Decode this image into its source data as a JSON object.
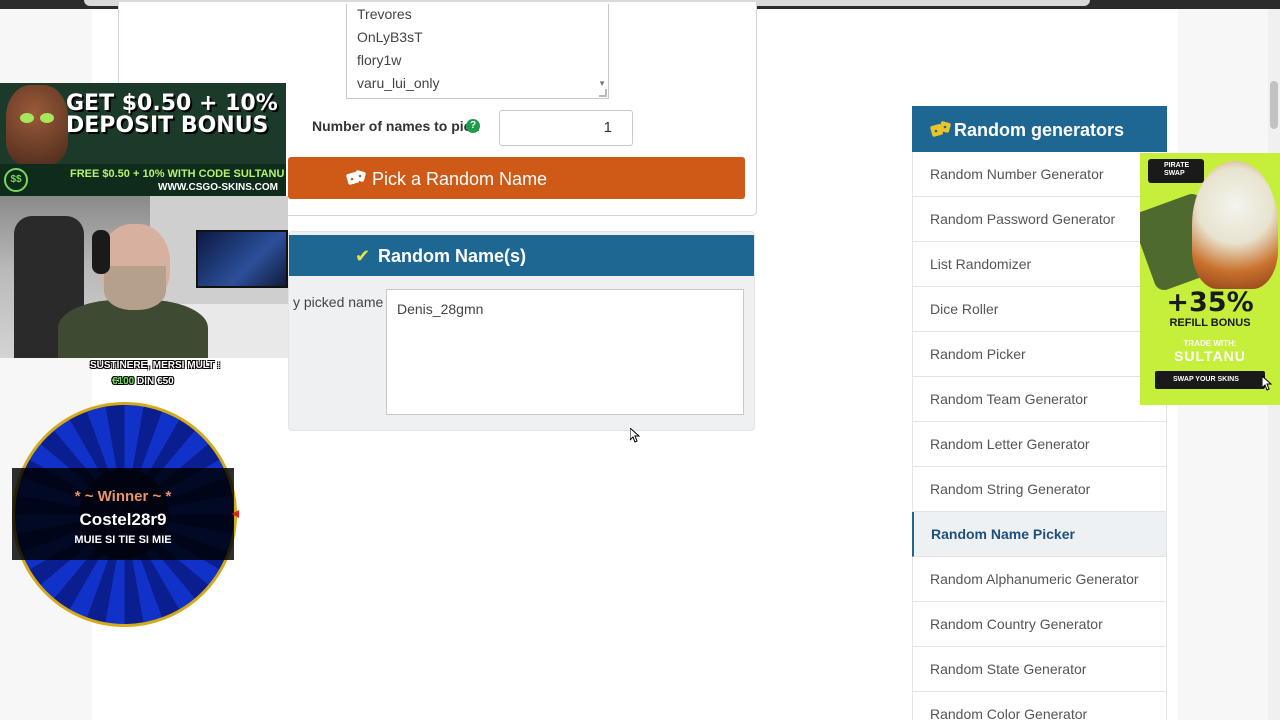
{
  "names_list": {
    "visible_names": [
      "Trevores",
      "OnLyB3sT",
      "flory1w",
      "varu_lui_only"
    ]
  },
  "pick_count": {
    "label": "Number of names to pick",
    "help_icon": "question-circle-icon",
    "value": "1"
  },
  "pick_button": {
    "label": "Pick a Random Name",
    "icon": "dice-icon"
  },
  "result": {
    "title": "Random Name(s)",
    "icon": "check-icon",
    "picked_label": "y picked name",
    "value": "Denis_28gmn"
  },
  "sidebar": {
    "title": "Random generators",
    "icon": "dice-icon",
    "items": [
      "Random Number Generator",
      "Random Password Generator",
      "List Randomizer",
      "Dice Roller",
      "Random Picker",
      "Random Team Generator",
      "Random Letter Generator",
      "Random String Generator",
      "Random Name Picker",
      "Random Alphanumeric Generator",
      "Random Country Generator",
      "Random State Generator",
      "Random Color Generator"
    ],
    "active_item": "Random Name Picker"
  },
  "overlay": {
    "banner": {
      "headline": "GET $0.50 + 10% DEPOSIT BONUS",
      "code_text": "FREE $0.50 + 10% WITH CODE SULTANU",
      "site": "WWW.CSGO-SKINS.COM"
    },
    "support": {
      "line1": "SUSTINERE, MERSI MULT :",
      "amount": "€100",
      "line2_rest": " DIN €50"
    },
    "wheel": {
      "winner_label": "* ~ Winner ~ *",
      "winner_name": "Costel28r9",
      "subtitle": "MUIE SI TIE SI MIE"
    },
    "skins_ad": {
      "logo": "PIRATE SWAP",
      "bonus": "+35%",
      "bonus_label": "REFILL BONUS",
      "trade_label": "TRADE WITH:",
      "code": "SULTANU",
      "cta": "SWAP YOUR SKINS"
    }
  },
  "colors": {
    "header_blue": "#1f6793",
    "pick_orange": "#cf5a17",
    "help_green": "#1e9e4a",
    "dice_yellow": "#e9c42a",
    "ad_lime": "#c5ef3a"
  }
}
